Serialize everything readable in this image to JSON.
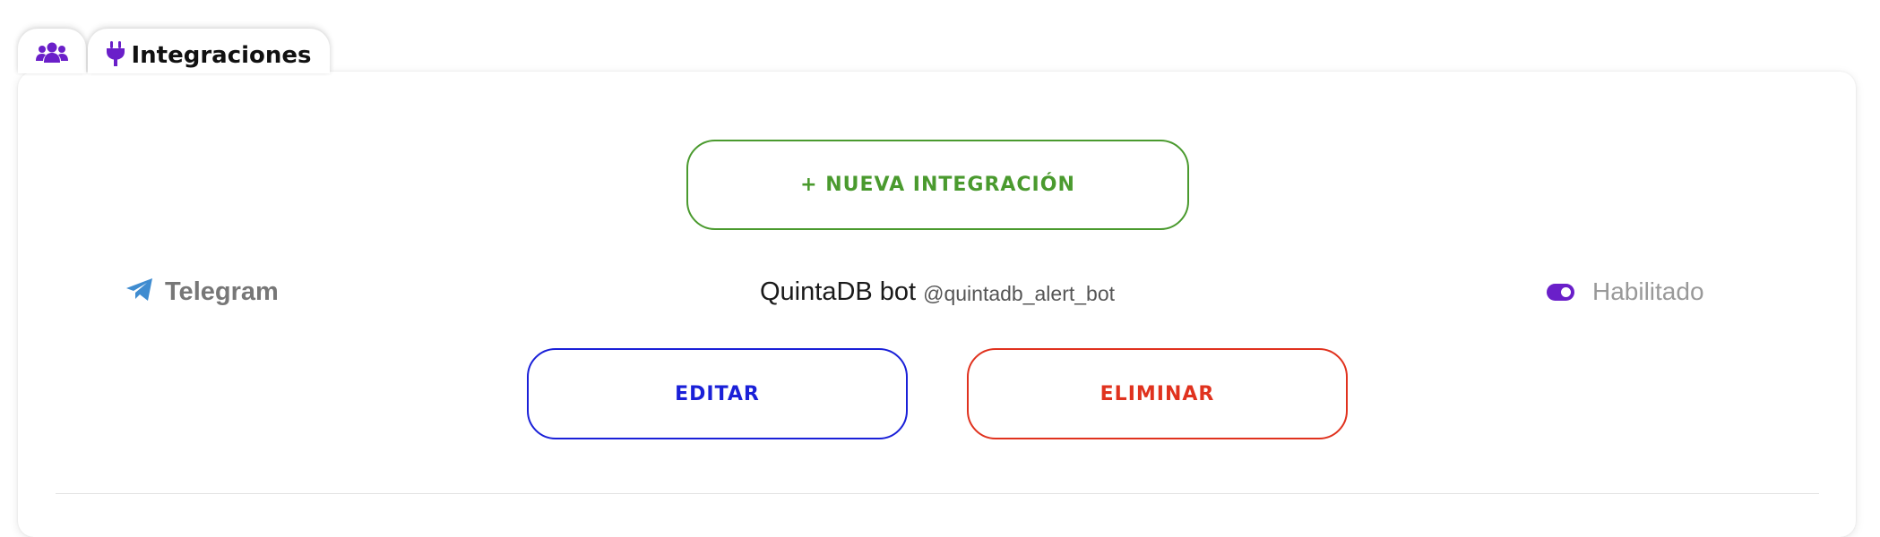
{
  "tabs": {
    "users_icon": "users-icon",
    "integrations_icon": "plug-icon",
    "integrations_label": "Integraciones"
  },
  "actions": {
    "new_integration_label": "+ NUEVA INTEGRACIÓN",
    "edit_label": "EDITAR",
    "delete_label": "ELIMINAR"
  },
  "integration": {
    "provider_icon": "telegram-icon",
    "provider": "Telegram",
    "bot_name": "QuintaDB bot",
    "bot_handle": "@quintadb_alert_bot",
    "status_label": "Habilitado",
    "enabled": true
  },
  "colors": {
    "accent_purple": "#6a1fc9",
    "new_green": "#4a9a2e",
    "edit_blue": "#1a20d8",
    "delete_red": "#e0321e",
    "telegram_blue": "#3f8cd0"
  }
}
